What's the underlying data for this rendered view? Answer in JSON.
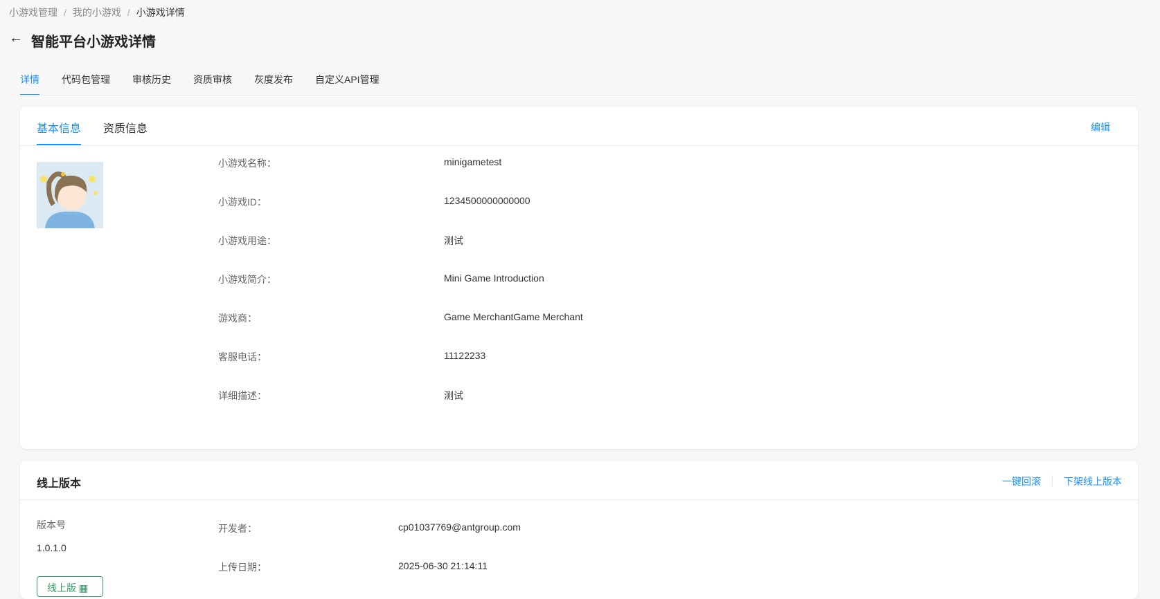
{
  "breadcrumb": [
    "小游戏管理",
    "我的小游戏",
    "小游戏详情"
  ],
  "page_title": "智能平台小游戏详情",
  "tabs": [
    "详情",
    "代码包管理",
    "审核历史",
    "资质审核",
    "灰度发布",
    "自定义API管理"
  ],
  "basic_card": {
    "tabs": [
      "基本信息",
      "资质信息"
    ],
    "edit_label": "编辑",
    "fields": [
      {
        "label": "小游戏名称：",
        "value": "minigametest"
      },
      {
        "label": "小游戏ID：",
        "value": "1234500000000000"
      },
      {
        "label": "小游戏用途：",
        "value": "测试"
      },
      {
        "label": "小游戏简介：",
        "value": "Mini Game Introduction"
      },
      {
        "label": "游戏商：",
        "value": "Game MerchantGame Merchant"
      },
      {
        "label": "客服电话：",
        "value": "11122233"
      },
      {
        "label": "详细描述：",
        "value": "测试"
      }
    ]
  },
  "online_card": {
    "title": "线上版本",
    "rollback_label": "一键回滚",
    "offline_label": "下架线上版本",
    "version_label": "版本号",
    "version": "1.0.1.0",
    "badge": "线上版",
    "fields": [
      {
        "label": "开发者：",
        "value": "cp01037769@antgroup.com"
      },
      {
        "label": "上传日期：",
        "value": "2025-06-30 21:14:11"
      }
    ]
  }
}
